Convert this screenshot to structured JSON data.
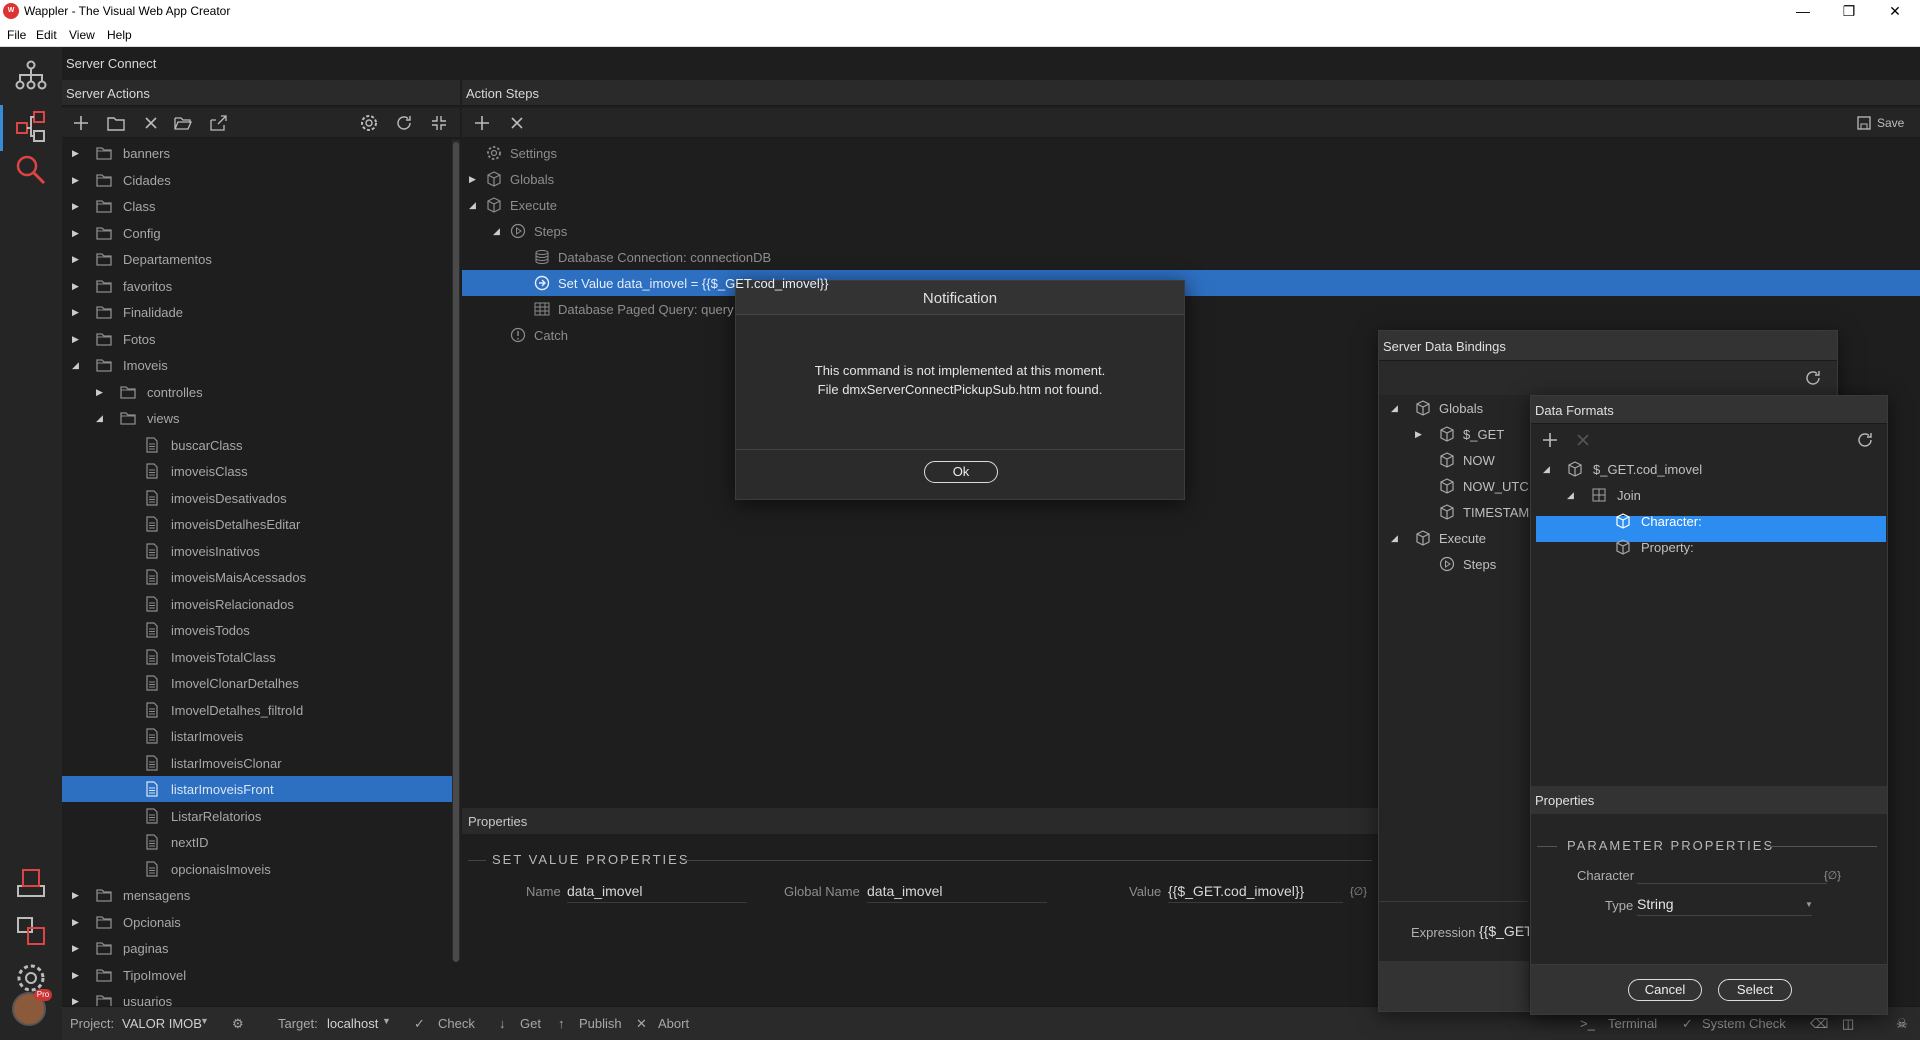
{
  "window": {
    "title": "Wappler - The Visual Web App Creator"
  },
  "menu": [
    "File",
    "Edit",
    "View",
    "Help"
  ],
  "top_header": "Server Connect",
  "server_actions": {
    "header": "Server Actions",
    "tree": [
      {
        "label": "banners",
        "type": "folder",
        "level": 0,
        "expanded": false
      },
      {
        "label": "Cidades",
        "type": "folder",
        "level": 0,
        "expanded": false
      },
      {
        "label": "Class",
        "type": "folder",
        "level": 0,
        "expanded": false
      },
      {
        "label": "Config",
        "type": "folder",
        "level": 0,
        "expanded": false
      },
      {
        "label": "Departamentos",
        "type": "folder",
        "level": 0,
        "expanded": false
      },
      {
        "label": "favoritos",
        "type": "folder",
        "level": 0,
        "expanded": false
      },
      {
        "label": "Finalidade",
        "type": "folder",
        "level": 0,
        "expanded": false
      },
      {
        "label": "Fotos",
        "type": "folder",
        "level": 0,
        "expanded": false
      },
      {
        "label": "Imoveis",
        "type": "folder",
        "level": 0,
        "expanded": true
      },
      {
        "label": "controlles",
        "type": "folder",
        "level": 1,
        "expanded": false
      },
      {
        "label": "views",
        "type": "folder",
        "level": 1,
        "expanded": true
      },
      {
        "label": "buscarClass",
        "type": "file",
        "level": 2
      },
      {
        "label": "imoveisClass",
        "type": "file",
        "level": 2
      },
      {
        "label": "imoveisDesativados",
        "type": "file",
        "level": 2
      },
      {
        "label": "imoveisDetalhesEditar",
        "type": "file",
        "level": 2
      },
      {
        "label": "imoveisInativos",
        "type": "file",
        "level": 2
      },
      {
        "label": "imoveisMaisAcessados",
        "type": "file",
        "level": 2
      },
      {
        "label": "imoveisRelacionados",
        "type": "file",
        "level": 2
      },
      {
        "label": "imoveisTodos",
        "type": "file",
        "level": 2
      },
      {
        "label": "ImoveisTotalClass",
        "type": "file",
        "level": 2
      },
      {
        "label": "ImovelClonarDetalhes",
        "type": "file",
        "level": 2
      },
      {
        "label": "ImovelDetalhes_filtroId",
        "type": "file",
        "level": 2
      },
      {
        "label": "listarImoveis",
        "type": "file",
        "level": 2
      },
      {
        "label": "listarImoveisClonar",
        "type": "file",
        "level": 2
      },
      {
        "label": "listarImoveisFront",
        "type": "file",
        "level": 2,
        "selected": true
      },
      {
        "label": "ListarRelatorios",
        "type": "file",
        "level": 2
      },
      {
        "label": "nextID",
        "type": "file",
        "level": 2
      },
      {
        "label": "opcionaisImoveis",
        "type": "file",
        "level": 2
      },
      {
        "label": "mensagens",
        "type": "folder",
        "level": 0,
        "expanded": false
      },
      {
        "label": "Opcionais",
        "type": "folder",
        "level": 0,
        "expanded": false
      },
      {
        "label": "paginas",
        "type": "folder",
        "level": 0,
        "expanded": false
      },
      {
        "label": "TipoImovel",
        "type": "folder",
        "level": 0,
        "expanded": false
      },
      {
        "label": "usuarios",
        "type": "folder",
        "level": 0,
        "expanded": false
      }
    ]
  },
  "action_steps": {
    "header": "Action Steps",
    "save_label": "Save",
    "steps": [
      {
        "label": "Settings",
        "icon": "gear-icon"
      },
      {
        "label": "Globals",
        "icon": "cube-icon"
      },
      {
        "label": "Execute",
        "icon": "cube-icon"
      },
      {
        "label": "Steps",
        "icon": "play-icon"
      },
      {
        "label": "Database Connection: connectionDB",
        "icon": "database-icon"
      },
      {
        "label": "Set Value data_imovel = {{$_GET.cod_imovel}}",
        "icon": "set-value-icon",
        "selected": true
      },
      {
        "label": "Database Paged Query: query",
        "icon": "table-icon"
      },
      {
        "label": "Catch",
        "icon": "info-icon"
      }
    ]
  },
  "properties": {
    "header": "Properties",
    "section_title": "SET VALUE PROPERTIES",
    "name_label": "Name",
    "name_value": "data_imovel",
    "global_name_label": "Global Name",
    "global_name_value": "data_imovel",
    "value_label": "Value",
    "value_value": "{{$_GET.cod_imovel}}",
    "binding_icon": "{∅}"
  },
  "notification": {
    "title": "Notification",
    "line1": "This command is not implemented at this moment.",
    "line2": "File dmxServerConnectPickupSub.htm not found.",
    "ok_label": "Ok"
  },
  "server_data_bindings": {
    "title": "Server Data Bindings",
    "tree": [
      {
        "label": "Globals",
        "level": 0,
        "arrow": "down"
      },
      {
        "label": "$_GET",
        "level": 1,
        "arrow": "right"
      },
      {
        "label": "NOW",
        "level": 1
      },
      {
        "label": "NOW_UTC",
        "level": 1
      },
      {
        "label": "TIMESTAMP",
        "level": 1
      },
      {
        "label": "Execute",
        "level": 0,
        "arrow": "down"
      },
      {
        "label": "Steps",
        "level": 1
      }
    ],
    "expression_label": "Expression",
    "expression_value": "{{$_GET.cod_imovel}}"
  },
  "data_formats": {
    "title": "Data Formats",
    "tree": [
      {
        "label": "$_GET.cod_imovel",
        "level": 0,
        "arrow": "down"
      },
      {
        "label": "Join",
        "level": 1,
        "arrow": "down"
      },
      {
        "label": "Character:",
        "level": 2,
        "selected": true
      },
      {
        "label": "Property:",
        "level": 2
      }
    ],
    "properties_header": "Properties",
    "param_title": "PARAMETER PROPERTIES",
    "character_label": "Character",
    "character_value": "",
    "type_label": "Type",
    "type_value": "String",
    "cancel_label": "Cancel",
    "select_label": "Select"
  },
  "statusbar": {
    "project_label": "Project:",
    "project_value": "VALOR IMOB",
    "target_label": "Target:",
    "target_value": "localhost",
    "check": "Check",
    "get": "Get",
    "publish": "Publish",
    "abort": "Abort",
    "terminal": "Terminal",
    "system_check": "System Check"
  },
  "colors": {
    "accent": "#2d6fc1",
    "selection_bright": "#2d8cf0",
    "brand_red": "#d33333"
  }
}
